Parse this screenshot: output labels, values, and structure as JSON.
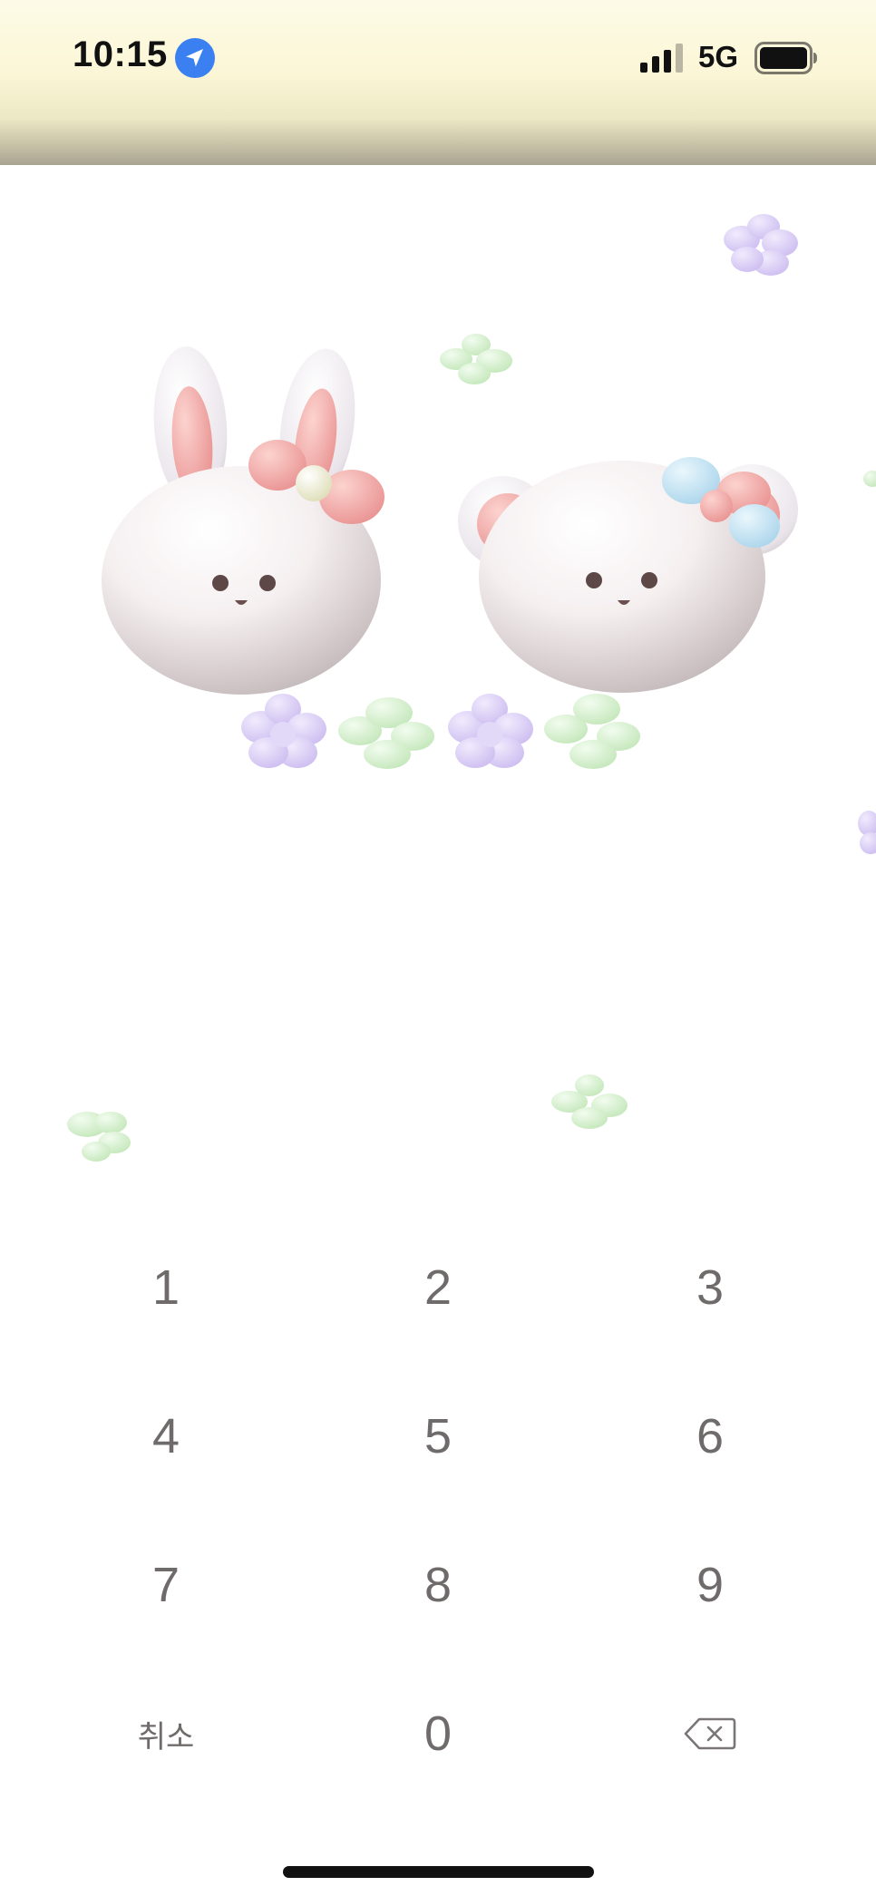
{
  "status_bar": {
    "time": "10:15",
    "network": "5G",
    "location_icon": "location-arrow-icon",
    "signal_icon": "cellular-signal-icon",
    "battery_icon": "battery-icon"
  },
  "keypad": {
    "digits": [
      "1",
      "2",
      "3",
      "4",
      "5",
      "6",
      "7",
      "8",
      "9"
    ],
    "zero": "0",
    "cancel_label": "취소",
    "delete_icon": "backspace-icon"
  },
  "wallpaper": {
    "characters": [
      "bunny",
      "bear"
    ],
    "colors": {
      "accent_blue": "#3a80f0",
      "flower_purple": "#dccff5",
      "flower_green": "#d6f1cf",
      "bow_pink": "#f4aaa8",
      "bow_blue": "#cfe8f5"
    }
  }
}
